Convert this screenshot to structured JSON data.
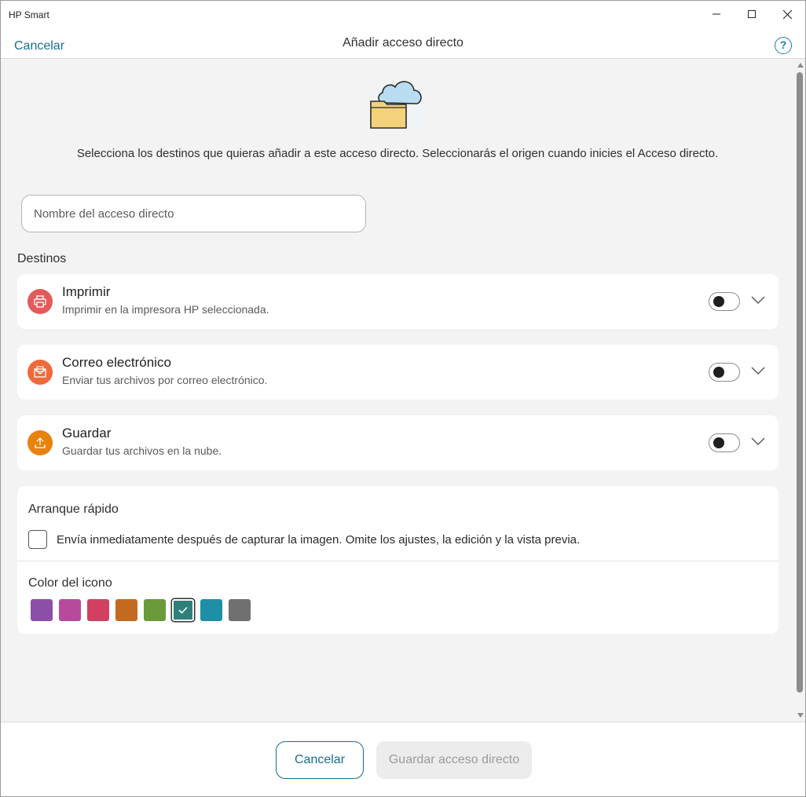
{
  "window": {
    "app_title": "HP Smart"
  },
  "header": {
    "cancel_label": "Cancelar",
    "title": "Añadir acceso directo",
    "help_label": "?"
  },
  "intro_text": "Selecciona los destinos que quieras añadir a este acceso directo. Seleccionarás el origen cuando inicies el Acceso directo.",
  "name_field": {
    "placeholder": "Nombre del acceso directo",
    "value": ""
  },
  "destinations": {
    "label": "Destinos",
    "items": [
      {
        "title": "Imprimir",
        "subtitle": "Imprimir en la impresora HP seleccionada.",
        "icon": "printer-icon",
        "color": "#e25a5a",
        "enabled": false
      },
      {
        "title": "Correo electrónico",
        "subtitle": "Enviar tus archivos por correo electrónico.",
        "icon": "email-icon",
        "color": "#ee6a3a",
        "enabled": false
      },
      {
        "title": "Guardar",
        "subtitle": "Guardar tus archivos en la nube.",
        "icon": "upload-icon",
        "color": "#e8820c",
        "enabled": false
      }
    ]
  },
  "quick_start": {
    "title": "Arranque rápido",
    "checkbox_label": "Envía inmediatamente después de capturar la imagen. Omite los ajustes, la edición y la vista previa.",
    "checked": false
  },
  "icon_color": {
    "title": "Color del icono",
    "swatches": [
      "#8b4fa8",
      "#b84a9e",
      "#d14060",
      "#c46a20",
      "#6a9a3a",
      "#2f7f7a",
      "#1f8fa8",
      "#707070"
    ],
    "selected_index": 5
  },
  "footer": {
    "cancel_label": "Cancelar",
    "save_label": "Guardar acceso directo"
  }
}
